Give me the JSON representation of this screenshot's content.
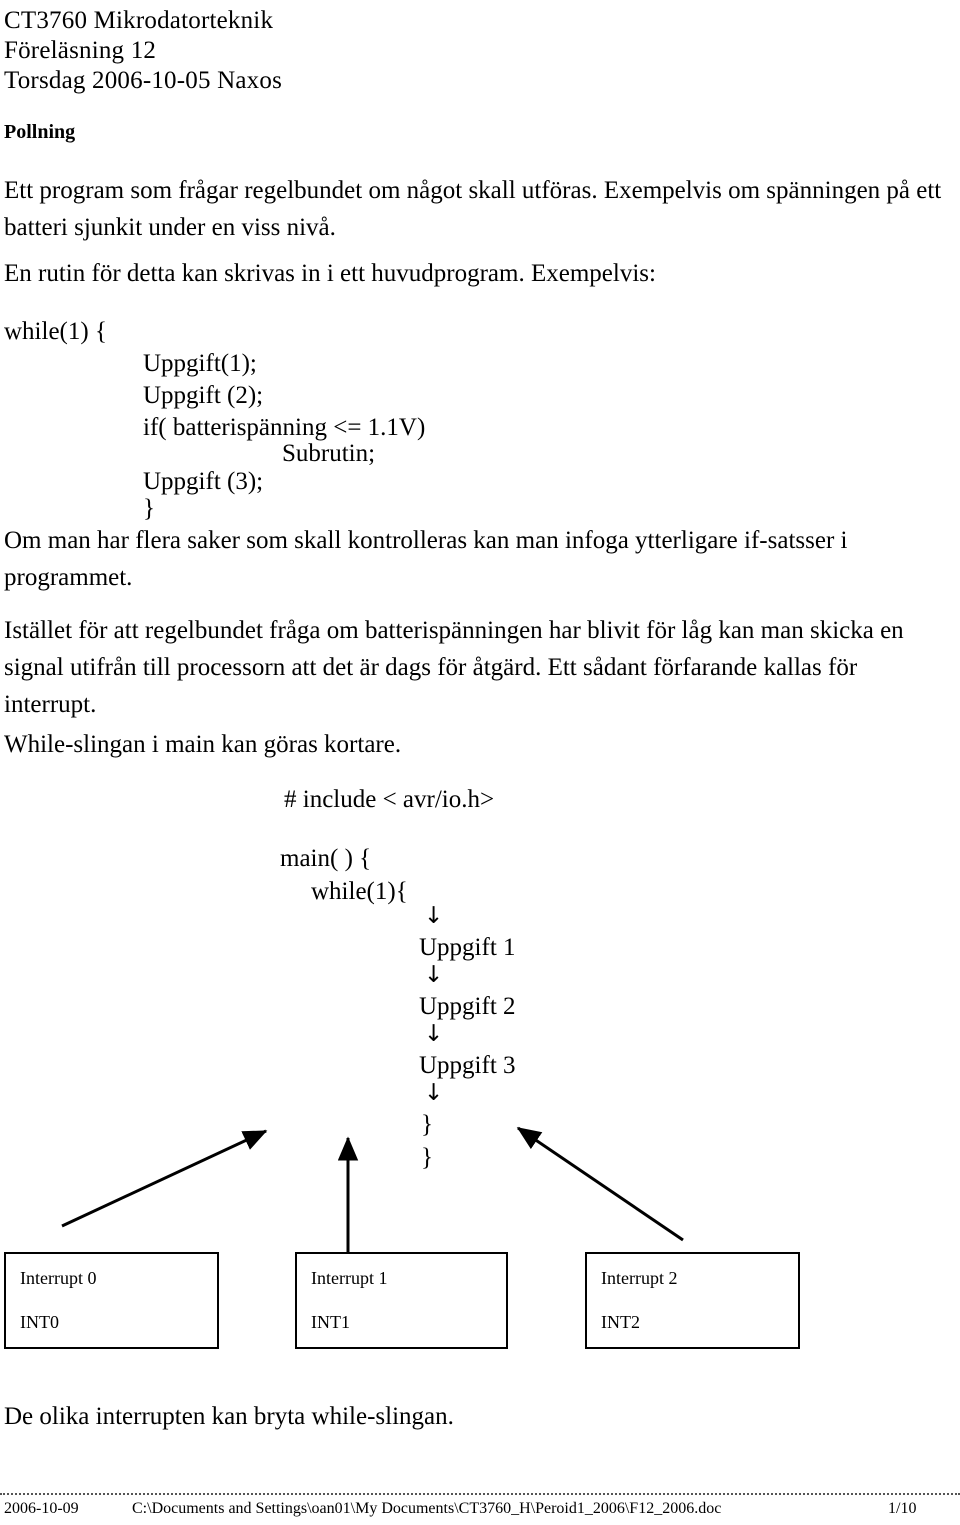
{
  "document": {
    "header": {
      "course": "CT3760 Mikrodatorteknik",
      "lecture": "Föreläsning 12",
      "date_place": "Torsdag 2006-10-05 Naxos"
    },
    "section_heading": "Pollning",
    "paragraphs": {
      "p1": "Ett program som frågar regelbundet om något skall utföras. Exempelvis om spänningen på ett batteri sjunkit under en viss nivå.",
      "p2": "En rutin för detta kan skrivas in i ett huvudprogram. Exempelvis:",
      "p3": "Om man har flera saker som skall kontrolleras kan man infoga ytterligare if-satsser i programmet.",
      "p4": "Istället för att regelbundet fråga om batterispänningen har blivit för låg kan man skicka en signal utifrån till processorn att det är dags för åtgärd. Ett sådant förfarande kallas för interrupt.",
      "p5": "While-slingan i main kan göras kortare.",
      "p6": "De olika interrupten kan bryta while-slingan."
    },
    "code_block_1": {
      "line1": "while(1) {",
      "line2": "Uppgift(1);",
      "line3": "Uppgift (2);",
      "line4": "if( batterispänning <= 1.1V)",
      "line5": "Subrutin;",
      "line6": "Uppgift (3);",
      "line7": "}"
    },
    "code_block_2": {
      "include": "# include < avr/io.h>",
      "main": "main( ) {",
      "while": "while(1){",
      "task1": "Uppgift 1",
      "task2": "Uppgift 2",
      "task3": "Uppgift 3",
      "close1": "}",
      "close2": "}",
      "arrow_glyph": "↓"
    },
    "interrupt_boxes": [
      {
        "title": "Interrupt 0",
        "signal": "INT0"
      },
      {
        "title": "Interrupt 1",
        "signal": "INT1"
      },
      {
        "title": "Interrupt 2",
        "signal": "INT2"
      }
    ],
    "footer": {
      "date": "2006-10-09",
      "path": "C:\\Documents and Settings\\oan01\\My Documents\\CT3760_H\\Peroid1_2006\\F12_2006.doc",
      "page": "1/10"
    }
  }
}
